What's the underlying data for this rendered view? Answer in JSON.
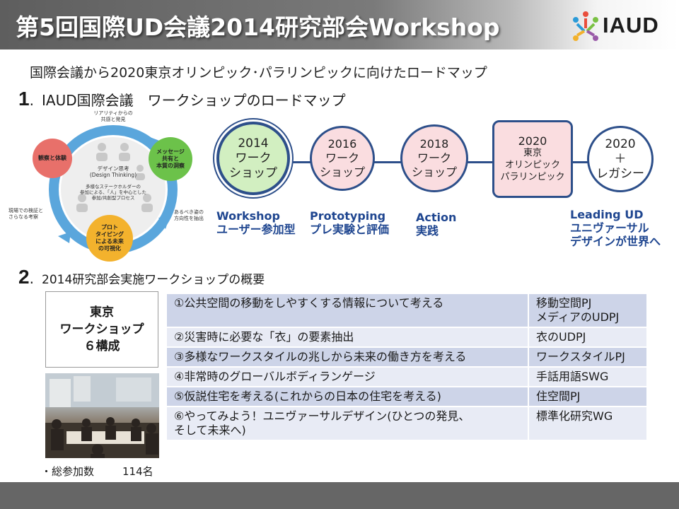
{
  "header": {
    "title": "第5回国際UD会議2014研究部会Workshop",
    "logo_text": "IAUD"
  },
  "subtitle": "国際会議から2020東京オリンピック･パラリンピックに向けたロードマップ",
  "section1": {
    "number": "1",
    "title": "IAUD国際会議　ワークショップのロードマップ"
  },
  "cycle": {
    "top_label": "リアリティからの\n共感と発見",
    "left_bubble": "観察と体験",
    "right_bubble": "メッセージ\n共有と\n本質の洞察",
    "bottom_bubble": "プロト\nタイピング\nによる未来\nの可視化",
    "center_title": "デザイン思考\n(Design Thinking)",
    "center_text": "多様なステークホルダーの\n参加による、「人」を中心とした\n参加/共創型プロセス",
    "left_label": "現場での検証と\nさらなる考察",
    "right_label": "あるべき姿の\n方向性を抽出",
    "colors": {
      "left": "#e8706a",
      "right": "#6cc24a",
      "bottom": "#f3b22d",
      "arrow": "#5aa6dc"
    }
  },
  "roadmap": {
    "nodes": [
      {
        "lines": [
          "2014",
          "ワーク",
          "ショップ"
        ]
      },
      {
        "lines": [
          "2016",
          "ワーク",
          "ショップ"
        ]
      },
      {
        "lines": [
          "2018",
          "ワーク",
          "ショップ"
        ]
      },
      {
        "lines": [
          "2020",
          "東京",
          "オリンピック",
          "パラリンピック"
        ]
      },
      {
        "lines": [
          "2020",
          "＋",
          "レガシー"
        ]
      }
    ],
    "phases": [
      {
        "line1": "Workshop",
        "line2": "ユーザー参加型"
      },
      {
        "line1": "Prototyping",
        "line2": "プレ実験と評価"
      },
      {
        "line1": "Action",
        "line2": "実践"
      },
      {
        "line1": "Leading UD",
        "line2": "ユニヴァーサル",
        "line3": "デザインが世界へ"
      }
    ]
  },
  "section2": {
    "number": "2",
    "title": "2014研究部会実施ワークショップの概要"
  },
  "tokyo_box": {
    "line1": "東京",
    "line2": "ワークショップ",
    "line3": "６構成"
  },
  "total": {
    "label": "・総参加数",
    "count": "114名"
  },
  "workshops": [
    {
      "topic": "①公共空間の移動をしやすくする情報について考える",
      "group": "移動空間PJ\nメディアのUDPJ"
    },
    {
      "topic": "②災害時に必要な「衣」の要素抽出",
      "group": "衣のUDPJ"
    },
    {
      "topic": "③多様なワークスタイルの兆しから未来の働き方を考える",
      "group": "ワークスタイルPJ"
    },
    {
      "topic": "④非常時のグローバルボディランゲージ",
      "group": "手話用語SWG"
    },
    {
      "topic": "⑤仮説住宅を考える(これからの日本の住宅を考える)",
      "group": "住空間PJ"
    },
    {
      "topic": "⑥やってみよう！ユニヴァーサルデザイン(ひとつの発見、\nそして未来へ)",
      "group": "標準化研究WG"
    }
  ],
  "colors": {
    "accent": "#1f4690",
    "road": "#2d4f8a",
    "row_dark": "#cdd4e8",
    "row_light": "#e8ebf5"
  }
}
